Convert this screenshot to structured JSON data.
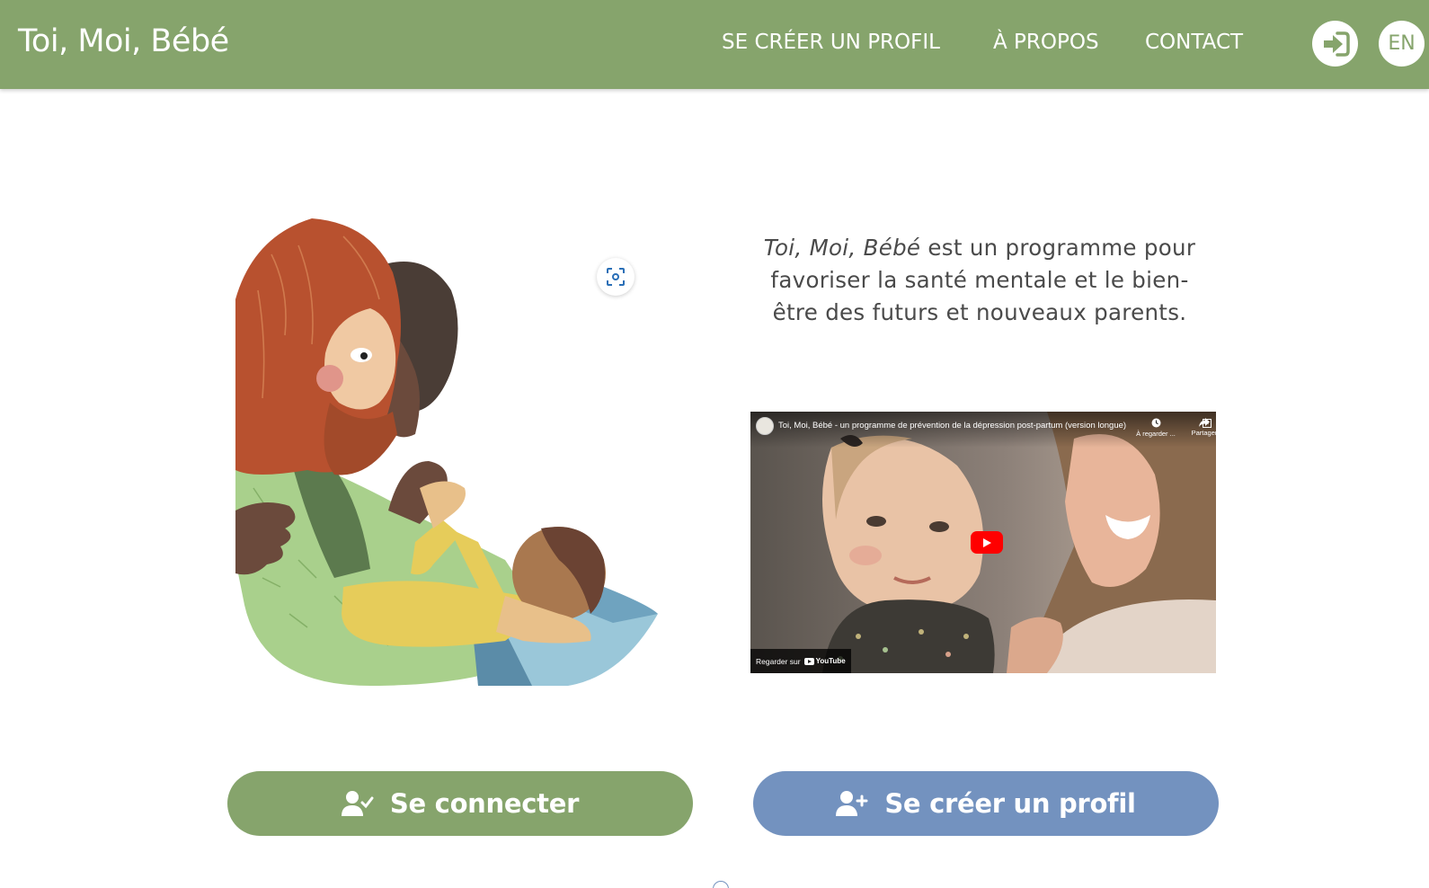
{
  "header": {
    "brand": "Toi, Moi, Bébé",
    "nav": [
      "SE CRÉER UN PROFIL",
      "À PROPOS",
      "CONTACT"
    ],
    "lang_label": "EN",
    "bg_color": "#86a46c"
  },
  "illustration": {
    "icon": "parents-with-baby-illustration",
    "zoom_icon": "focus-scan-icon"
  },
  "intro": {
    "italic": "Toi, Moi, Bébé",
    "rest": " est un programme pour favoriser la santé mentale et le bien-être des futurs et nouveaux parents."
  },
  "video": {
    "title": "Toi, Moi, Bébé - un programme de prévention de la dépression post-partum (version longue)",
    "watch_later": "À regarder ...",
    "share": "Partager",
    "watch_on": "Regarder sur",
    "youtube": "YouTube"
  },
  "buttons": {
    "login": "Se connecter",
    "signup": "Se créer un profil",
    "login_color": "#86a46c",
    "signup_color": "#7392bf"
  }
}
